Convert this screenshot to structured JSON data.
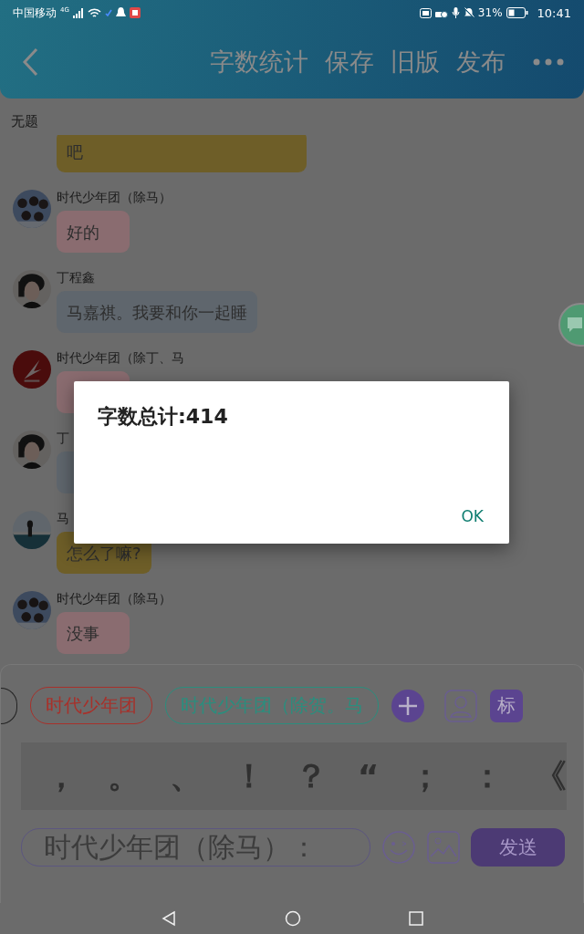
{
  "status_bar": {
    "carrier": "中国移动",
    "network": "4G",
    "battery": "31%",
    "time": "10:41"
  },
  "header": {
    "actions": [
      "字数统计",
      "保存",
      "旧版",
      "发布"
    ]
  },
  "title": "无题",
  "messages": [
    {
      "text": "吧",
      "color": "#6e5e28"
    },
    {
      "sender": "时代少年团（除马）",
      "text": "好的",
      "color": "#8a6c70"
    },
    {
      "sender": "丁程鑫",
      "text": "马嘉祺。我要和你一起睡",
      "color": "#5f666d"
    },
    {
      "sender": "时代少年团（除丁、马",
      "color": "#8a6c70"
    },
    {
      "sender": "丁",
      "color": "#5f666d"
    },
    {
      "sender": "马",
      "text": "怎么了嘛?",
      "color": "#6e5e28"
    },
    {
      "sender": "时代少年团（除马）",
      "text": "没事",
      "color": "#8a6c70"
    }
  ],
  "roles": [
    {
      "label": "时代少年团",
      "color": "#a8302a"
    },
    {
      "label": "时代少年团（除贺。马",
      "color": "#2a8e7e"
    }
  ],
  "tag_button": "标",
  "punctuation": [
    "，",
    "。",
    "、",
    "！",
    "？",
    "“",
    "；",
    "：",
    "《"
  ],
  "input": {
    "value": "时代少年团（除马）："
  },
  "send_button": "发送",
  "dialog": {
    "message": "字数总计:414",
    "button": "OK"
  }
}
